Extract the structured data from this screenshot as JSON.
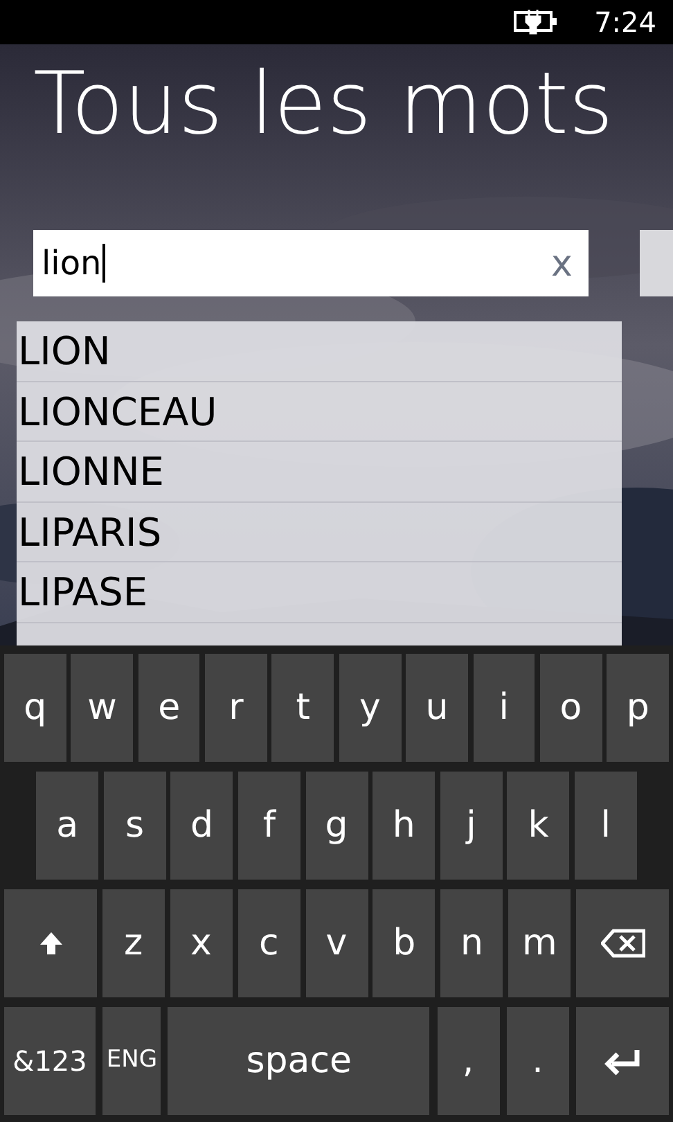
{
  "status_bar": {
    "time": "7:24",
    "charging": true
  },
  "title": "Tous les mots",
  "search": {
    "value": "lion",
    "clear_label": "x"
  },
  "suggestions": [
    {
      "text": "LION"
    },
    {
      "text": "LIONCEAU"
    },
    {
      "text": "LIONNE"
    },
    {
      "text": "LIPARIS"
    },
    {
      "text": "LIPASE"
    }
  ],
  "keyboard": {
    "top_row": [
      {
        "kind": "letter",
        "label": "q"
      },
      {
        "kind": "letter",
        "label": "w"
      },
      {
        "kind": "letter",
        "label": "e"
      },
      {
        "kind": "letter",
        "label": "r"
      },
      {
        "kind": "letter",
        "label": "t"
      },
      {
        "kind": "letter",
        "label": "y"
      },
      {
        "kind": "letter",
        "label": "u"
      },
      {
        "kind": "letter",
        "label": "i"
      },
      {
        "kind": "letter",
        "label": "o"
      },
      {
        "kind": "letter",
        "label": "p"
      }
    ],
    "middle_row": [
      {
        "kind": "letter",
        "label": "a"
      },
      {
        "kind": "letter",
        "label": "s"
      },
      {
        "kind": "letter",
        "label": "d"
      },
      {
        "kind": "letter",
        "label": "f"
      },
      {
        "kind": "letter",
        "label": "g"
      },
      {
        "kind": "letter",
        "label": "h"
      },
      {
        "kind": "letter",
        "label": "j"
      },
      {
        "kind": "letter",
        "label": "k"
      },
      {
        "kind": "letter",
        "label": "l"
      }
    ],
    "bottom_row": [
      {
        "kind": "shift"
      },
      {
        "kind": "letter",
        "label": "z"
      },
      {
        "kind": "letter",
        "label": "x"
      },
      {
        "kind": "letter",
        "label": "c"
      },
      {
        "kind": "letter",
        "label": "v"
      },
      {
        "kind": "letter",
        "label": "b"
      },
      {
        "kind": "letter",
        "label": "n"
      },
      {
        "kind": "letter",
        "label": "m"
      },
      {
        "kind": "backspace"
      }
    ],
    "function_row": [
      {
        "kind": "symbols",
        "label": "&123"
      },
      {
        "kind": "language",
        "label": "ENG"
      },
      {
        "kind": "space",
        "label": "space"
      },
      {
        "kind": "letter",
        "label": ","
      },
      {
        "kind": "letter",
        "label": "."
      },
      {
        "kind": "enter"
      }
    ]
  }
}
